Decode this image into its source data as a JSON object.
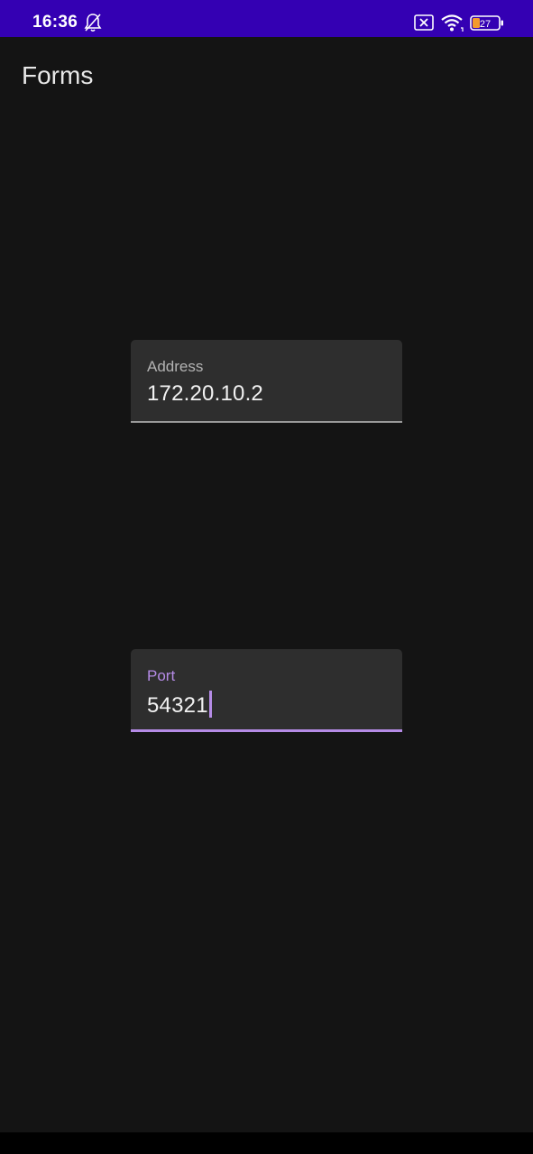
{
  "status_bar": {
    "time": "16:36",
    "battery_level": "27",
    "icons": [
      "bell-off-icon",
      "sim-x-icon",
      "wifi-icon",
      "battery-icon"
    ]
  },
  "app": {
    "title": "Forms"
  },
  "form": {
    "address": {
      "label": "Address",
      "value": "172.20.10.2"
    },
    "port": {
      "label": "Port",
      "value": "54321",
      "focused": true
    }
  },
  "colors": {
    "status_bar": "#3400b3",
    "background": "#141414",
    "field_background": "#2e2e2e",
    "accent": "#b58be6"
  }
}
